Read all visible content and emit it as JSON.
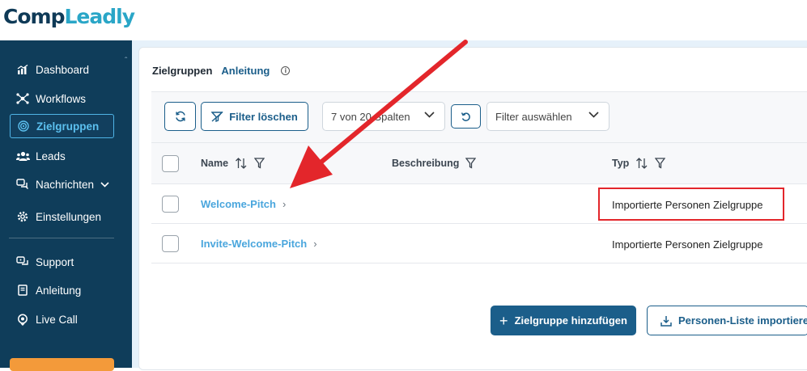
{
  "app": {
    "logo_part1": "Comp",
    "logo_part2": "Leadly"
  },
  "sidebar": {
    "items": [
      {
        "label": "Dashboard",
        "icon": "dashboard-chart-icon"
      },
      {
        "label": "Workflows",
        "icon": "workflow-nodes-icon"
      },
      {
        "label": "Zielgruppen",
        "icon": "target-icon",
        "active": true
      },
      {
        "label": "Leads",
        "icon": "users-icon"
      },
      {
        "label": "Nachrichten",
        "icon": "chat-icon",
        "has_chevron": true
      },
      {
        "label": "Einstellungen",
        "icon": "gear-icon"
      },
      {
        "label": "Support",
        "icon": "support-chat-icon"
      },
      {
        "label": "Anleitung",
        "icon": "book-icon"
      },
      {
        "label": "Live Call",
        "icon": "headset-icon"
      }
    ],
    "active_color": "#5cc0ef",
    "bg_color": "#0f3d5a"
  },
  "breadcrumb": {
    "current": "Zielgruppen",
    "link": "Anleitung",
    "info_icon": "info-icon"
  },
  "toolbar": {
    "refresh_icon": "refresh-icon",
    "filter_clear_label": "Filter löschen",
    "columns_select_value": "7 von 20 Spalten",
    "reset_icon": "undo-icon",
    "filter_select_placeholder": "Filter auswählen"
  },
  "table": {
    "columns": [
      {
        "label": "Name",
        "sortable": true,
        "filterable": true
      },
      {
        "label": "Beschreibung",
        "sortable": false,
        "filterable": true
      },
      {
        "label": "Typ",
        "sortable": true,
        "filterable": true
      }
    ],
    "rows": [
      {
        "name": "Welcome-Pitch",
        "beschreibung": "",
        "typ": "Importierte Personen Zielgruppe",
        "highlighted": true
      },
      {
        "name": "Invite-Welcome-Pitch",
        "beschreibung": "",
        "typ": "Importierte Personen Zielgruppe",
        "highlighted": false
      }
    ]
  },
  "actions": {
    "add_label": "Zielgruppe hinzufügen",
    "import_label": "Personen-Liste importieren"
  },
  "colors": {
    "primary": "#1b5e8a",
    "link": "#4aa6dd",
    "annotation_red": "#e3262b"
  }
}
